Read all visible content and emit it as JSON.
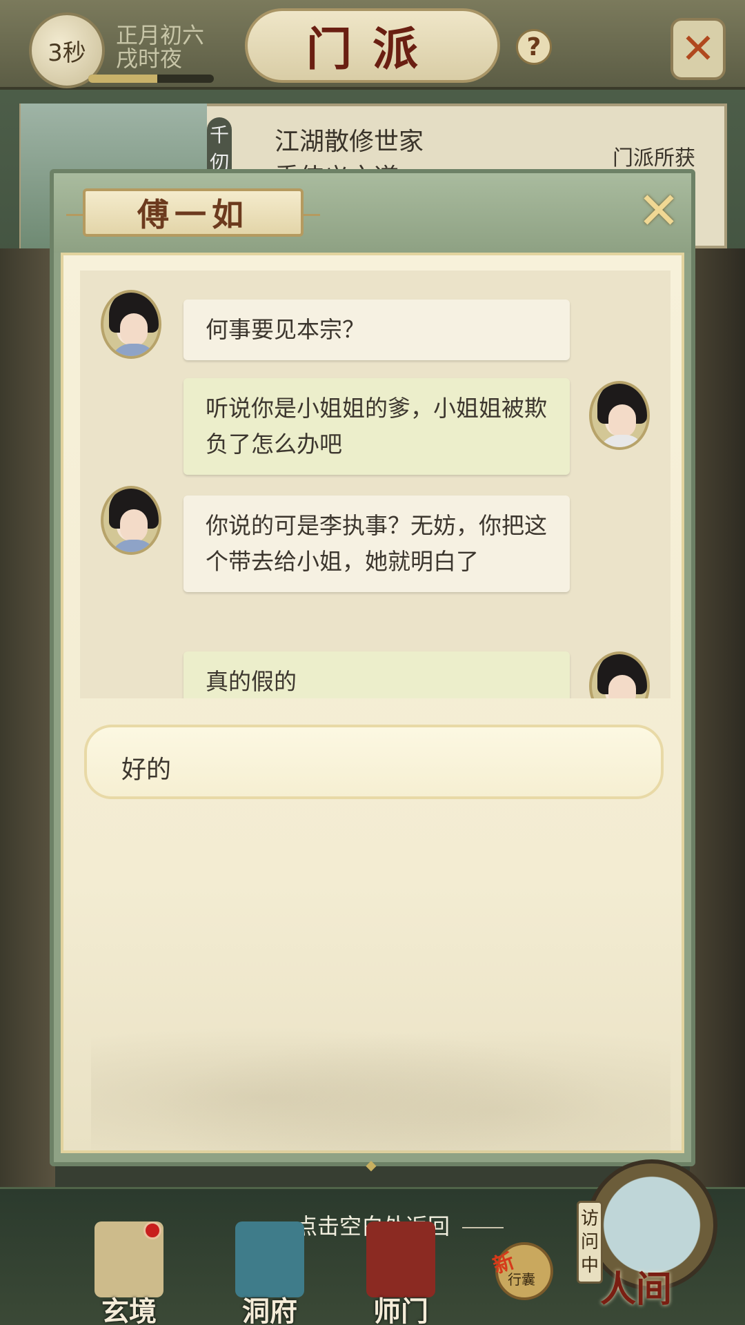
{
  "header": {
    "timer": "3秒",
    "timer_progress": 0.55,
    "date_line1": "正月初六",
    "date_line2": "戌时夜",
    "title": "门派",
    "help_symbol": "?",
    "close_symbol": "✕"
  },
  "background_panel": {
    "tag_text": "千仞",
    "line1": "江湖散修世家",
    "line2": "秉侠义之道",
    "reward_label": "门派所获"
  },
  "dialog": {
    "npc_name": "傅一如",
    "close_symbol": "✕",
    "messages": [
      {
        "speaker": "npc",
        "text": "何事要见本宗？"
      },
      {
        "speaker": "player",
        "text": "听说你是小姐姐的爹，小姐姐被欺负了怎么办吧"
      },
      {
        "speaker": "npc",
        "text": "你说的可是李执事？无妨，你把这个带去给小姐，她就明白了"
      },
      {
        "speaker": "player",
        "text": "真的假的"
      }
    ],
    "reply_option": "好的"
  },
  "footer": {
    "return_hint": "点击空白处返回",
    "nav": [
      {
        "label": "玄境"
      },
      {
        "label": "洞府"
      },
      {
        "label": "师门"
      }
    ],
    "bag_badge": "新",
    "bag_label": "行囊",
    "visiting_badge": "访问中",
    "renjian_label": "人间"
  },
  "colors": {
    "title_red": "#6a1f12",
    "dialog_green": "#8fa285",
    "paper": "#f7f1da",
    "notification_red": "#c81e1e"
  }
}
